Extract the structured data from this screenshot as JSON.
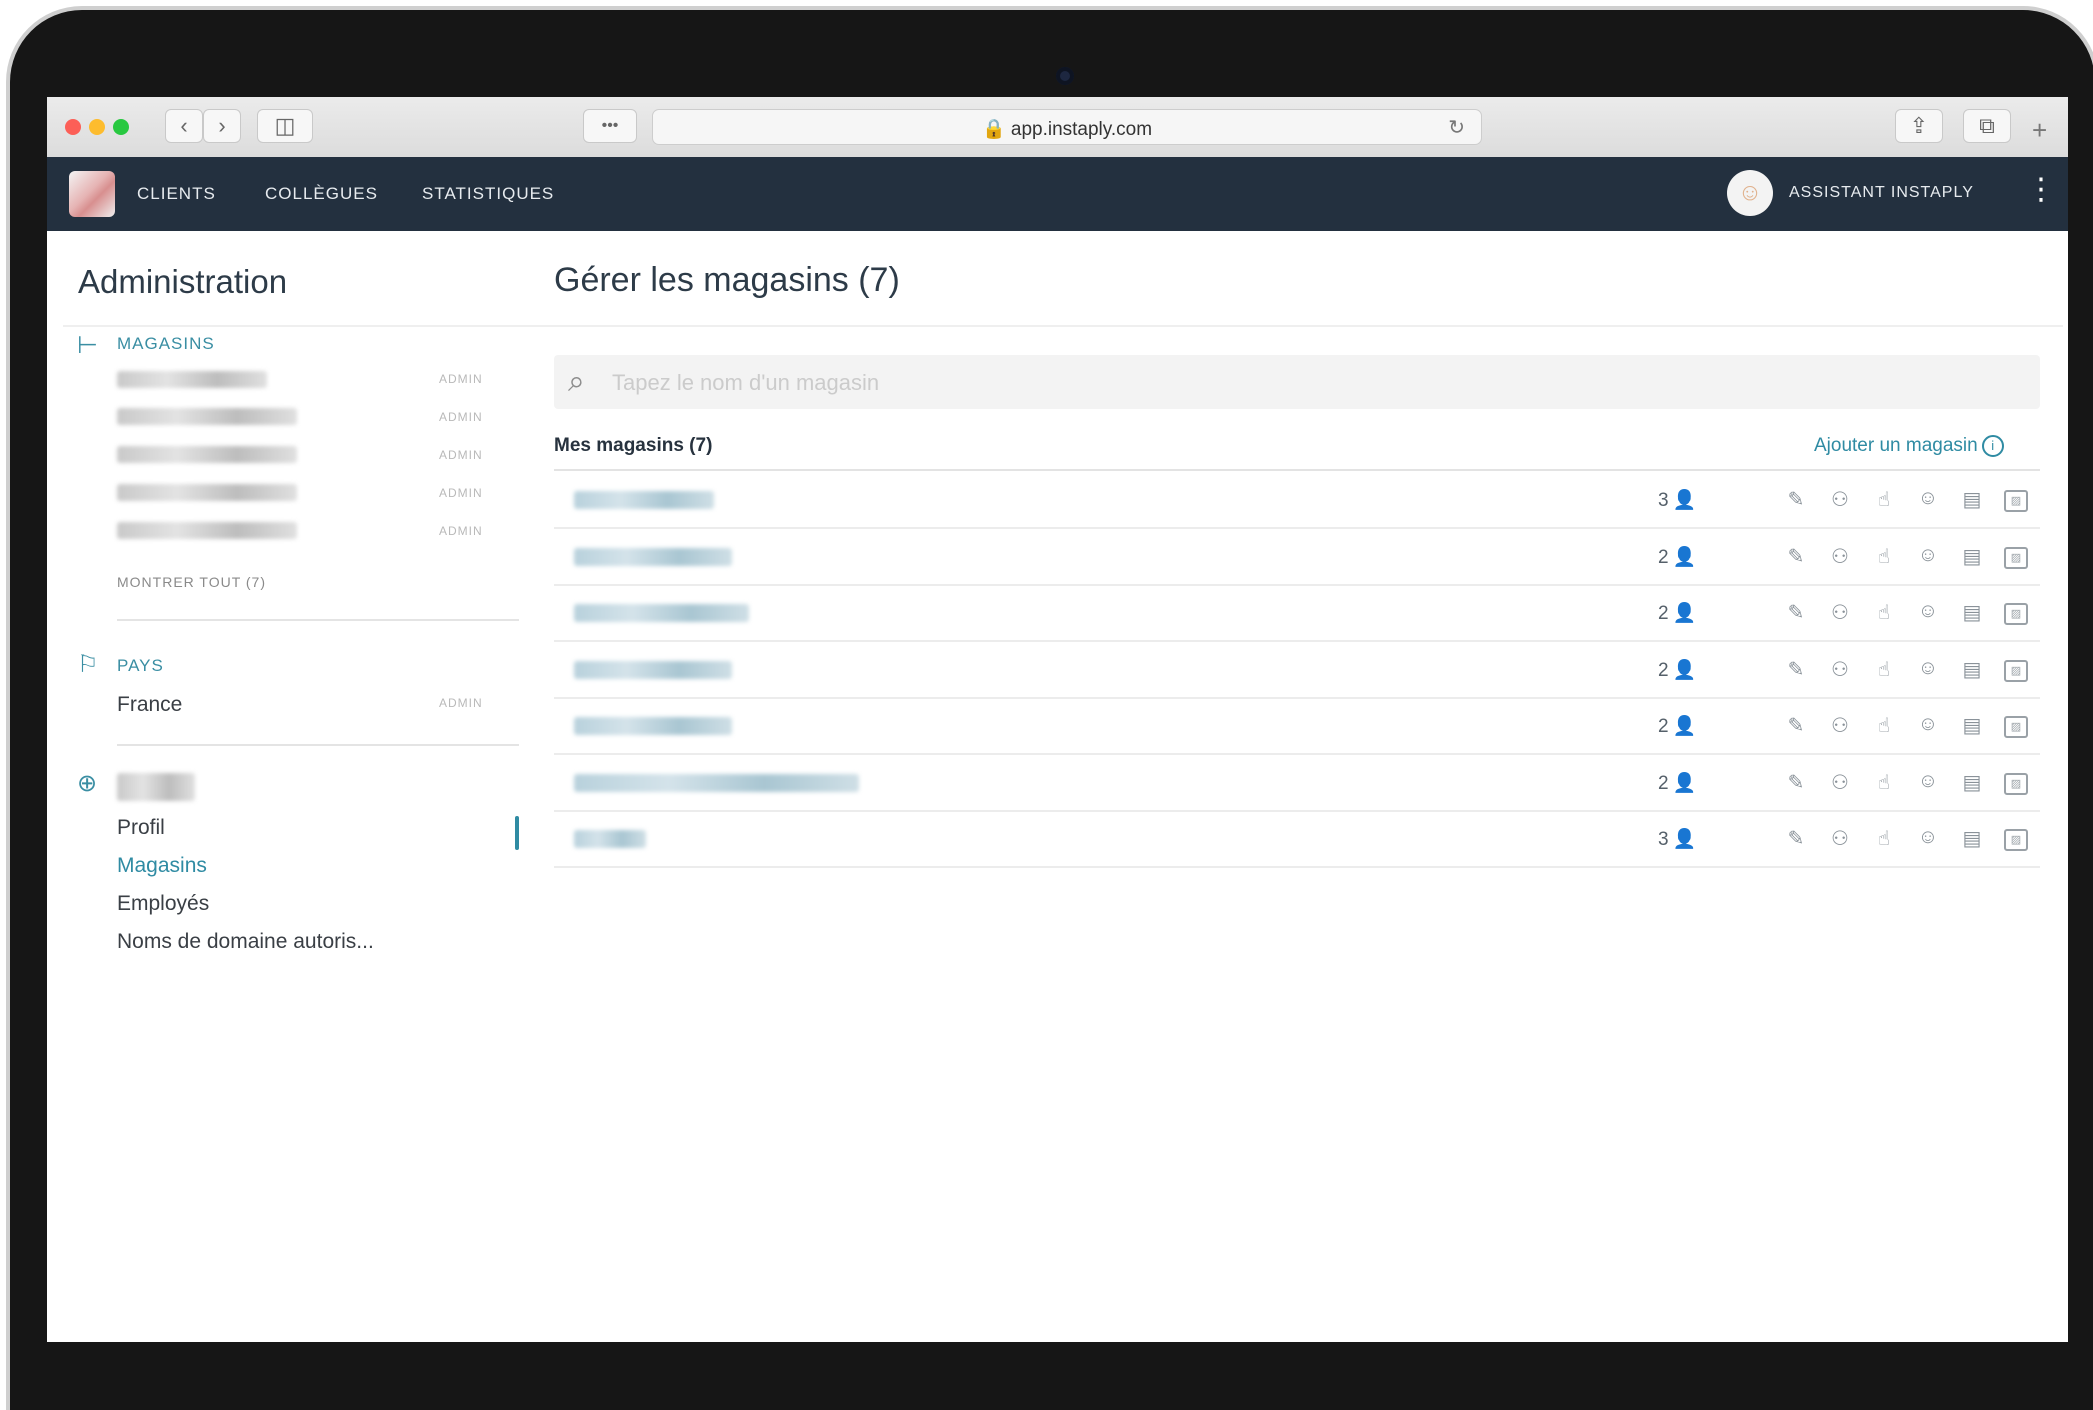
{
  "browser": {
    "url": "app.instaply.com",
    "lock_icon": "lock-icon",
    "more_label": "•••"
  },
  "nav": {
    "links": [
      "CLIENTS",
      "COLLÈGUES",
      "STATISTIQUES"
    ],
    "assistant_label": "ASSISTANT INSTAPLY"
  },
  "sidebar": {
    "title": "Administration",
    "magasins_label": "MAGASINS",
    "role_label": "ADMIN",
    "show_all": "MONTRER TOUT (7)",
    "pays_label": "PAYS",
    "country": "France",
    "items": [
      "Profil",
      "Magasins",
      "Employés",
      "Noms de domaine autoris..."
    ]
  },
  "main": {
    "title": "Gérer les magasins (7)",
    "search_placeholder": "Tapez le nom d'un magasin",
    "list_title": "Mes magasins (7)",
    "add_link": "Ajouter un magasin"
  },
  "stores": [
    {
      "count": "3"
    },
    {
      "count": "2"
    },
    {
      "count": "2"
    },
    {
      "count": "2"
    },
    {
      "count": "2"
    },
    {
      "count": "2"
    },
    {
      "count": "3"
    }
  ],
  "colors": {
    "nav_bg": "#23303f",
    "accent": "#2f8ba3"
  }
}
